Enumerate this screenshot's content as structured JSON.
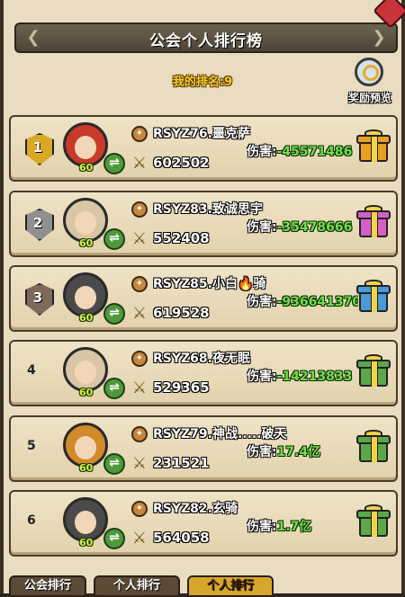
{
  "title": "公会个人排行榜",
  "my_rank_text": "我的排名:9",
  "reward_preview_label": "奖励预览",
  "damage_label": "伤害:",
  "colors": {
    "gold": "#d9a824",
    "silver": "#8f8f8f",
    "bronze": "#7d6a5a",
    "green_value": "#6fe04a",
    "yellow_label": "#f2cc2a"
  },
  "rows": [
    {
      "rank": "1",
      "name": "RSYZ76.噩克萨",
      "power": "602502",
      "damage": "-45571486",
      "level": "60",
      "gift_color": "#e8a020",
      "avatar_color": "#c93a28"
    },
    {
      "rank": "2",
      "name": "RSYZ83.致诚思宇",
      "power": "552408",
      "damage": "-35478666",
      "level": "60",
      "gift_color": "#d660c8",
      "avatar_color": "#d9c6a5"
    },
    {
      "rank": "3",
      "name": "RSYZ85.小白",
      "name_suffix": "骑",
      "power": "619528",
      "damage": "-936641370",
      "level": "60",
      "gift_color": "#4a9ad8",
      "avatar_color": "#4a4a4a"
    },
    {
      "rank": "4",
      "name": "RSYZ68.夜无眠",
      "power": "529365",
      "damage": "-14213833",
      "level": "60",
      "gift_color": "#5aa84a",
      "avatar_color": "#d9c6a5"
    },
    {
      "rank": "5",
      "name": "RSYZ79.神战.....破天",
      "power": "231521",
      "damage": "17.4亿",
      "level": "60",
      "gift_color": "#5aa84a",
      "avatar_color": "#d28a2a"
    },
    {
      "rank": "6",
      "name": "RSYZ82.玄骑",
      "power": "564058",
      "damage": "1.7亿",
      "level": "60",
      "gift_color": "#5aa84a",
      "avatar_color": "#4a4a4a"
    }
  ],
  "tabs": [
    {
      "label": "公会排行"
    },
    {
      "label": "个人排行"
    },
    {
      "label": "个人排行"
    }
  ]
}
